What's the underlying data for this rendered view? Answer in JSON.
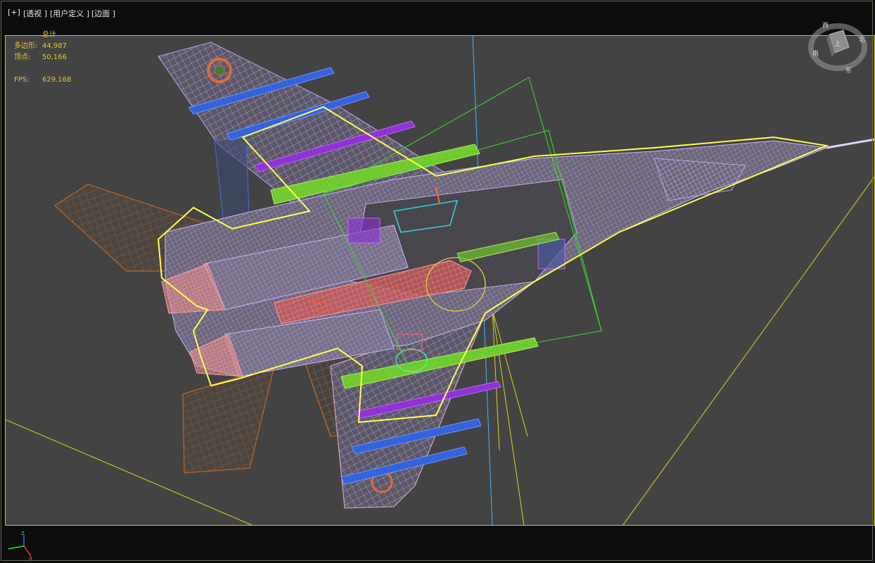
{
  "viewport_labels": {
    "plus": "[+]",
    "view": "[透视 ]",
    "shading": "[用户定义 ]",
    "edges": "[边面 ]"
  },
  "stats": {
    "header": "总计",
    "polygons_label": "多边形:",
    "polygons_value": "44,987",
    "vertices_label": "顶点:",
    "vertices_value": "50,166",
    "fps_label": "FPS:",
    "fps_value": "629.168"
  },
  "viewcube": {
    "icon": "viewcube-icon",
    "face_label": "上",
    "ring_labels": [
      "西",
      "南",
      "东",
      "北"
    ]
  },
  "axis_tripod": {
    "icon": "axis-tripod-icon",
    "z_label": "z",
    "x_label": "x"
  },
  "colors": {
    "viewport_bg": "#434343",
    "frame_yellow": "#d5c21a",
    "stats_text": "#e8c23a",
    "wire_lavender": "#b9a6f5",
    "wire_blue": "#2f5fd8",
    "wire_purple": "#8a2fd0",
    "wire_green": "#6fc52c",
    "wire_pink": "#f28b8b",
    "wire_orange": "#d66a1e",
    "selection_yellow": "#ffff50"
  }
}
